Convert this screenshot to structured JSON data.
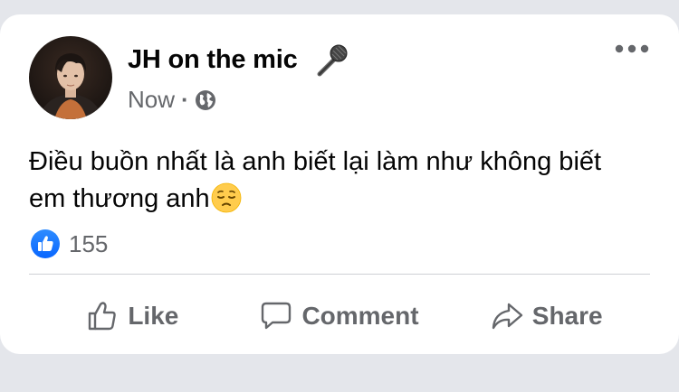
{
  "post": {
    "author": "JH on the mic",
    "author_emoji_icon": "microphone-icon",
    "timestamp": "Now",
    "audience_icon": "globe-icon",
    "text": "Điều buồn nhất là anh biết lại làm như không biết em thương anh",
    "text_emoji_icon": "pensive-face-icon",
    "reaction_icon": "like-reaction-icon",
    "reaction_count": "155"
  },
  "actions": {
    "like_label": "Like",
    "comment_label": "Comment",
    "share_label": "Share"
  },
  "colors": {
    "background": "#e4e6eb",
    "card": "#ffffff",
    "primary_text": "#050505",
    "secondary_text": "#65676b",
    "like_blue": "#1877f2",
    "divider": "#ced0d4"
  }
}
